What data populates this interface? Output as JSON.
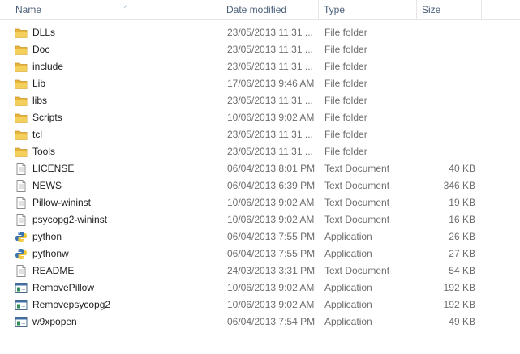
{
  "columns": {
    "name": "Name",
    "date": "Date modified",
    "type": "Type",
    "size": "Size"
  },
  "files": [
    {
      "name": "DLLs",
      "date": "23/05/2013 11:31 ...",
      "type": "File folder",
      "size": "",
      "icon": "folder-icon"
    },
    {
      "name": "Doc",
      "date": "23/05/2013 11:31 ...",
      "type": "File folder",
      "size": "",
      "icon": "folder-icon"
    },
    {
      "name": "include",
      "date": "23/05/2013 11:31 ...",
      "type": "File folder",
      "size": "",
      "icon": "folder-icon"
    },
    {
      "name": "Lib",
      "date": "17/06/2013 9:46 AM",
      "type": "File folder",
      "size": "",
      "icon": "folder-icon"
    },
    {
      "name": "libs",
      "date": "23/05/2013 11:31 ...",
      "type": "File folder",
      "size": "",
      "icon": "folder-icon"
    },
    {
      "name": "Scripts",
      "date": "10/06/2013 9:02 AM",
      "type": "File folder",
      "size": "",
      "icon": "folder-icon"
    },
    {
      "name": "tcl",
      "date": "23/05/2013 11:31 ...",
      "type": "File folder",
      "size": "",
      "icon": "folder-icon"
    },
    {
      "name": "Tools",
      "date": "23/05/2013 11:31 ...",
      "type": "File folder",
      "size": "",
      "icon": "folder-icon"
    },
    {
      "name": "LICENSE",
      "date": "06/04/2013 8:01 PM",
      "type": "Text Document",
      "size": "40 KB",
      "icon": "text-document-icon"
    },
    {
      "name": "NEWS",
      "date": "06/04/2013 6:39 PM",
      "type": "Text Document",
      "size": "346 KB",
      "icon": "text-document-icon"
    },
    {
      "name": "Pillow-wininst",
      "date": "10/06/2013 9:02 AM",
      "type": "Text Document",
      "size": "19 KB",
      "icon": "text-document-icon"
    },
    {
      "name": "psycopg2-wininst",
      "date": "10/06/2013 9:02 AM",
      "type": "Text Document",
      "size": "16 KB",
      "icon": "text-document-icon"
    },
    {
      "name": "python",
      "date": "06/04/2013 7:55 PM",
      "type": "Application",
      "size": "26 KB",
      "icon": "python-icon"
    },
    {
      "name": "pythonw",
      "date": "06/04/2013 7:55 PM",
      "type": "Application",
      "size": "27 KB",
      "icon": "python-icon"
    },
    {
      "name": "README",
      "date": "24/03/2013 3:31 PM",
      "type": "Text Document",
      "size": "54 KB",
      "icon": "text-document-icon"
    },
    {
      "name": "RemovePillow",
      "date": "10/06/2013 9:02 AM",
      "type": "Application",
      "size": "192 KB",
      "icon": "application-icon"
    },
    {
      "name": "Removepsycopg2",
      "date": "10/06/2013 9:02 AM",
      "type": "Application",
      "size": "192 KB",
      "icon": "application-icon"
    },
    {
      "name": "w9xpopen",
      "date": "06/04/2013 7:54 PM",
      "type": "Application",
      "size": "49 KB",
      "icon": "application-icon"
    }
  ]
}
